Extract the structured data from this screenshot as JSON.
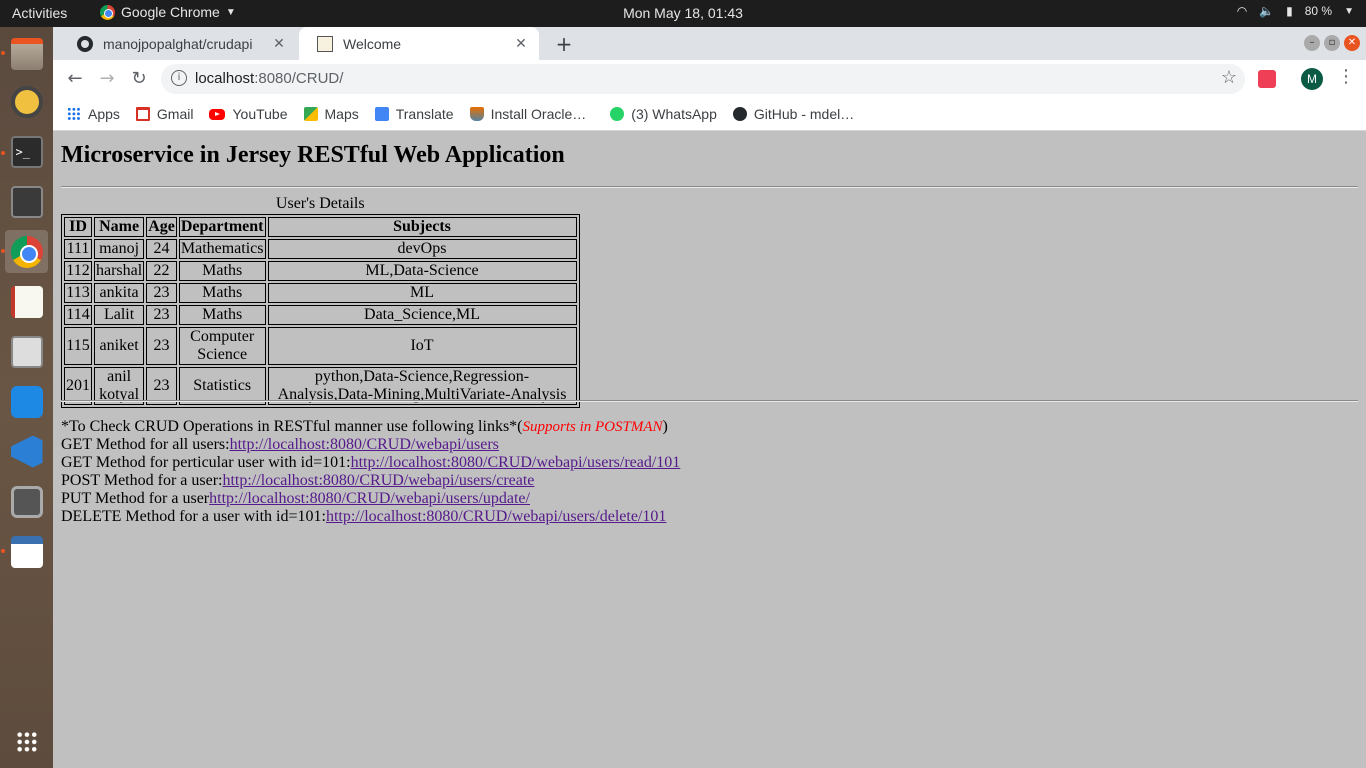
{
  "topbar": {
    "activities": "Activities",
    "app_name": "Google Chrome",
    "clock": "Mon May 18, 01:43",
    "battery": "80 %"
  },
  "tabs": [
    {
      "title": "manojpopalghat/crudapi",
      "active": false
    },
    {
      "title": "Welcome",
      "active": true
    }
  ],
  "omnibox": {
    "host": "localhost",
    "rest": ":8080/CRUD/"
  },
  "avatar_letter": "M",
  "bookmarks": [
    {
      "label": "Apps",
      "icon": "apps-icon"
    },
    {
      "label": "Gmail",
      "icon": "gmail-icon"
    },
    {
      "label": "YouTube",
      "icon": "youtube-icon"
    },
    {
      "label": "Maps",
      "icon": "maps-icon"
    },
    {
      "label": "Translate",
      "icon": "translate-icon"
    },
    {
      "label": "Install Oracle…",
      "icon": "java-icon"
    },
    {
      "label": "(3) WhatsApp",
      "icon": "whatsapp-icon"
    },
    {
      "label": "GitHub - mdel…",
      "icon": "github-icon"
    }
  ],
  "page": {
    "heading": "Microservice in Jersey RESTful Web Application",
    "table_caption": "User's Details",
    "columns": [
      "ID",
      "Name",
      "Age",
      "Department",
      "Subjects"
    ],
    "rows": [
      [
        "111",
        "manoj",
        "24",
        "Mathematics",
        "devOps"
      ],
      [
        "112",
        "harshal",
        "22",
        "Maths",
        "ML,Data-Science"
      ],
      [
        "113",
        "ankita",
        "23",
        "Maths",
        "ML"
      ],
      [
        "114",
        "Lalit",
        "23",
        "Maths",
        "Data_Science,ML"
      ],
      [
        "115",
        "aniket",
        "23",
        "Computer Science",
        "IoT"
      ],
      [
        "201",
        "anil kotyal",
        "23",
        "Statistics",
        "python,Data-Science,Regression-Analysis,Data-Mining,MultiVariate-Analysis"
      ]
    ],
    "intro": "*To Check CRUD Operations in RESTful manner use following links*(",
    "postman": "Supports in POSTMAN",
    "intro_end": ")",
    "links": [
      {
        "label": "GET Method for all users:",
        "url": "http://localhost:8080/CRUD/webapi/users"
      },
      {
        "label": "GET Method for perticular user with id=101:",
        "url": "http://localhost:8080/CRUD/webapi/users/read/101"
      },
      {
        "label": "POST Method for a user:",
        "url": "http://localhost:8080/CRUD/webapi/users/create"
      },
      {
        "label": "PUT Method for a user",
        "url": "http://localhost:8080/CRUD/webapi/users/update/"
      },
      {
        "label": "DELETE Method for a user with id=101:",
        "url": "http://localhost:8080/CRUD/webapi/users/delete/101"
      }
    ]
  }
}
